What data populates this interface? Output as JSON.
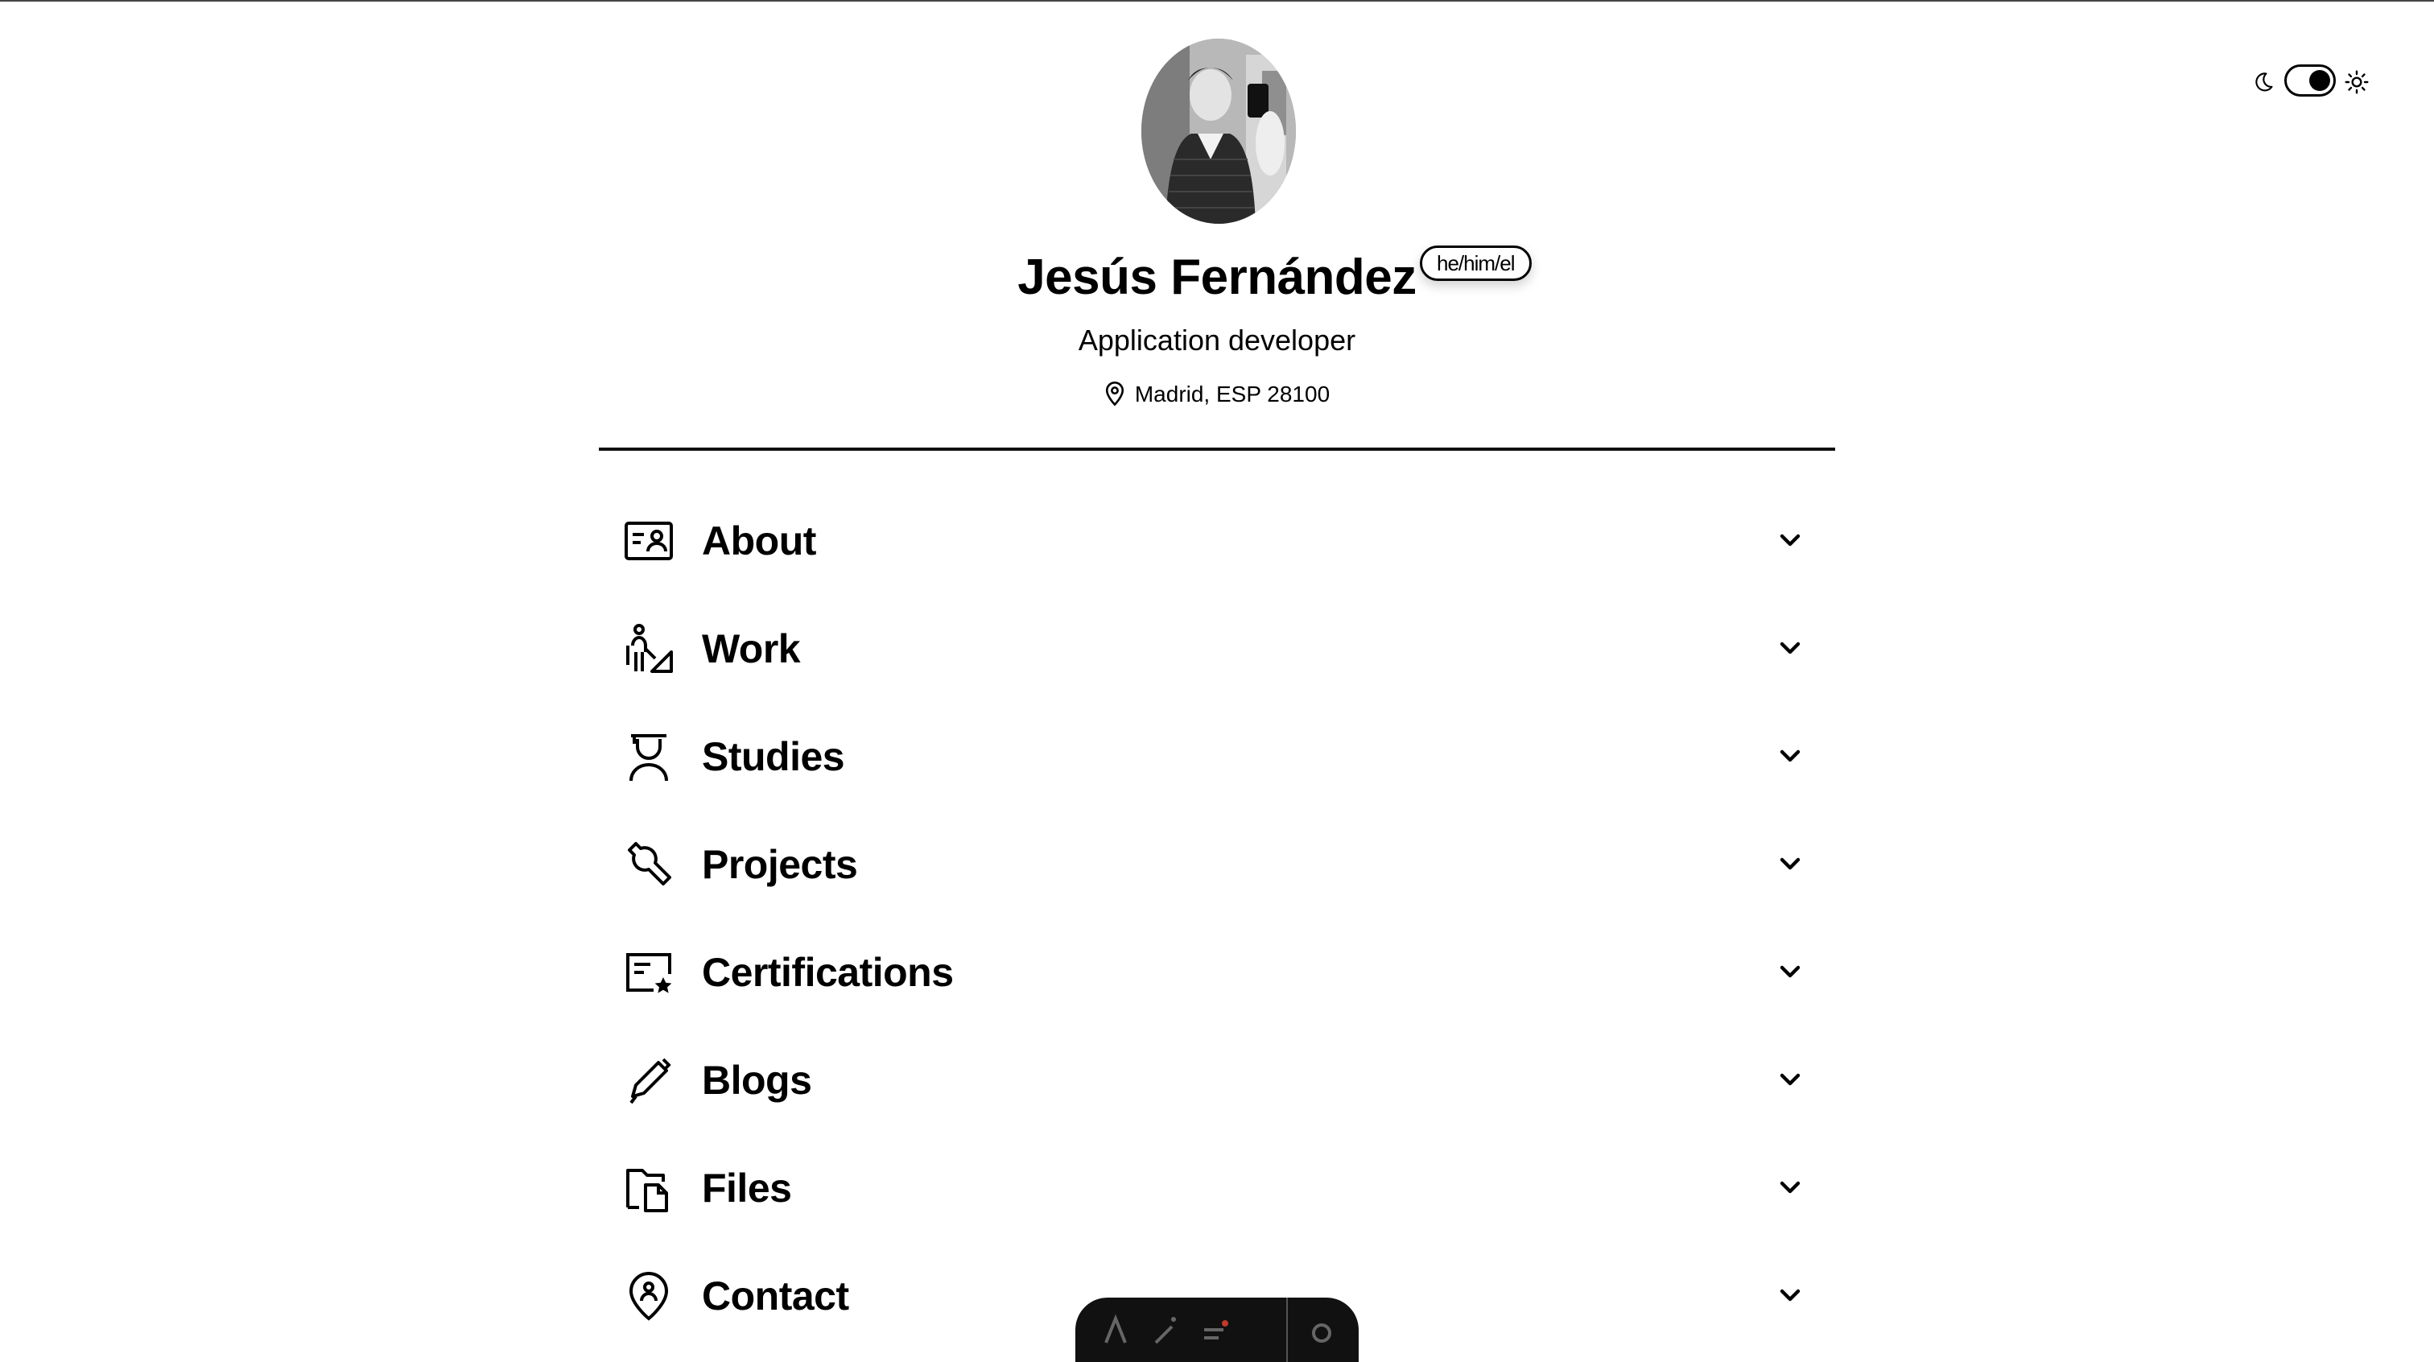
{
  "header": {
    "name": "Jesús Fernández",
    "pronouns": "he/him/el",
    "role": "Application developer",
    "location": "Madrid, ESP 28100"
  },
  "theme_toggle": {
    "state": "light"
  },
  "sections": [
    {
      "label": "About",
      "icon": "id-card-icon"
    },
    {
      "label": "Work",
      "icon": "worker-icon"
    },
    {
      "label": "Studies",
      "icon": "student-icon"
    },
    {
      "label": "Projects",
      "icon": "wrench-icon"
    },
    {
      "label": "Certifications",
      "icon": "certificate-icon"
    },
    {
      "label": "Blogs",
      "icon": "pencil-icon"
    },
    {
      "label": "Files",
      "icon": "files-icon"
    },
    {
      "label": "Contact",
      "icon": "location-person-icon"
    }
  ],
  "colors": {
    "text": "#000000",
    "background": "#ffffff",
    "dock": "#111111"
  }
}
